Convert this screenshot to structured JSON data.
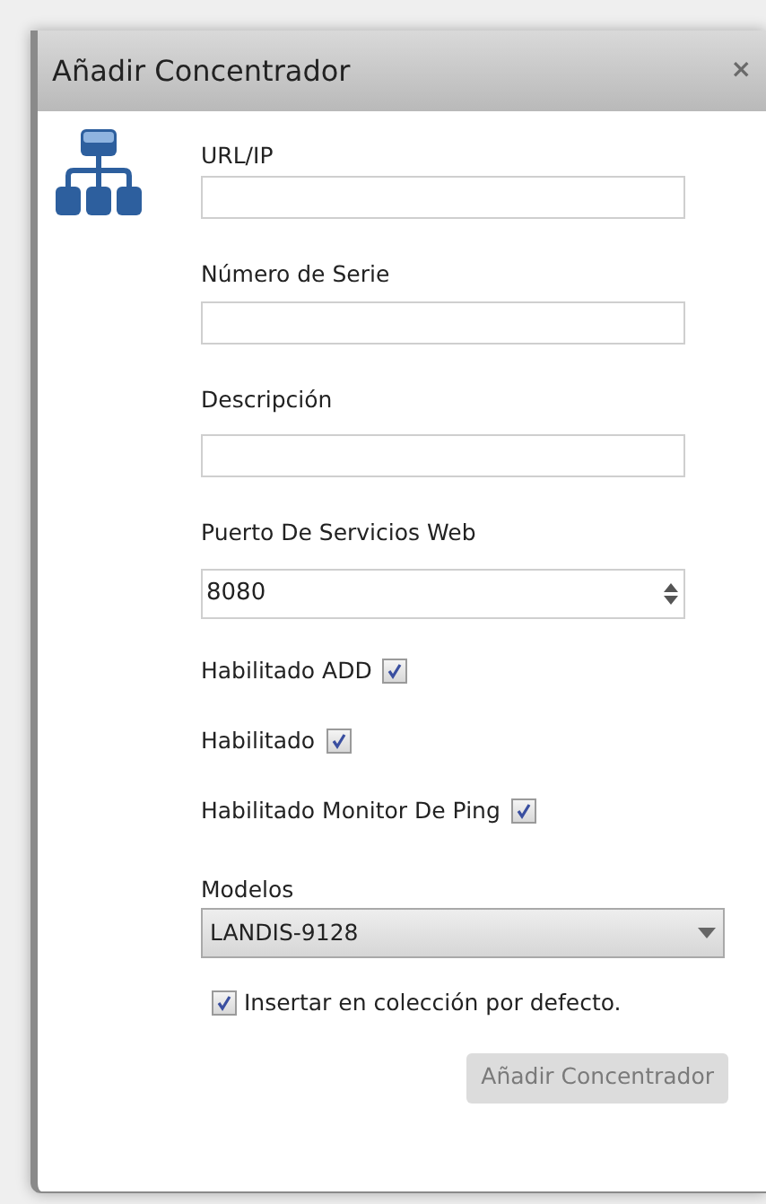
{
  "window": {
    "title": "Añadir Concentrador",
    "close": "×"
  },
  "fields": [
    {
      "kind": "text",
      "label": "URL/IP"
    },
    {
      "kind": "text",
      "label": "Número de Serie"
    },
    {
      "kind": "text",
      "label": "Descripción"
    },
    {
      "kind": "number",
      "label": "Puerto De Servicios Web",
      "value": "8080"
    }
  ],
  "checkboxes": [
    {
      "label": "Habilitado ADD",
      "checked": true
    },
    {
      "label": "Habilitado",
      "checked": true
    },
    {
      "label": "Habilitado Monitor De Ping",
      "checked": true
    }
  ],
  "model": {
    "label": "Modelos",
    "value": "LANDIS-9128"
  },
  "insert_default": {
    "label": "Insertar en colección por defecto.",
    "checked": true
  },
  "submit": {
    "label": "Añadir Concentrador",
    "disabled": true
  }
}
